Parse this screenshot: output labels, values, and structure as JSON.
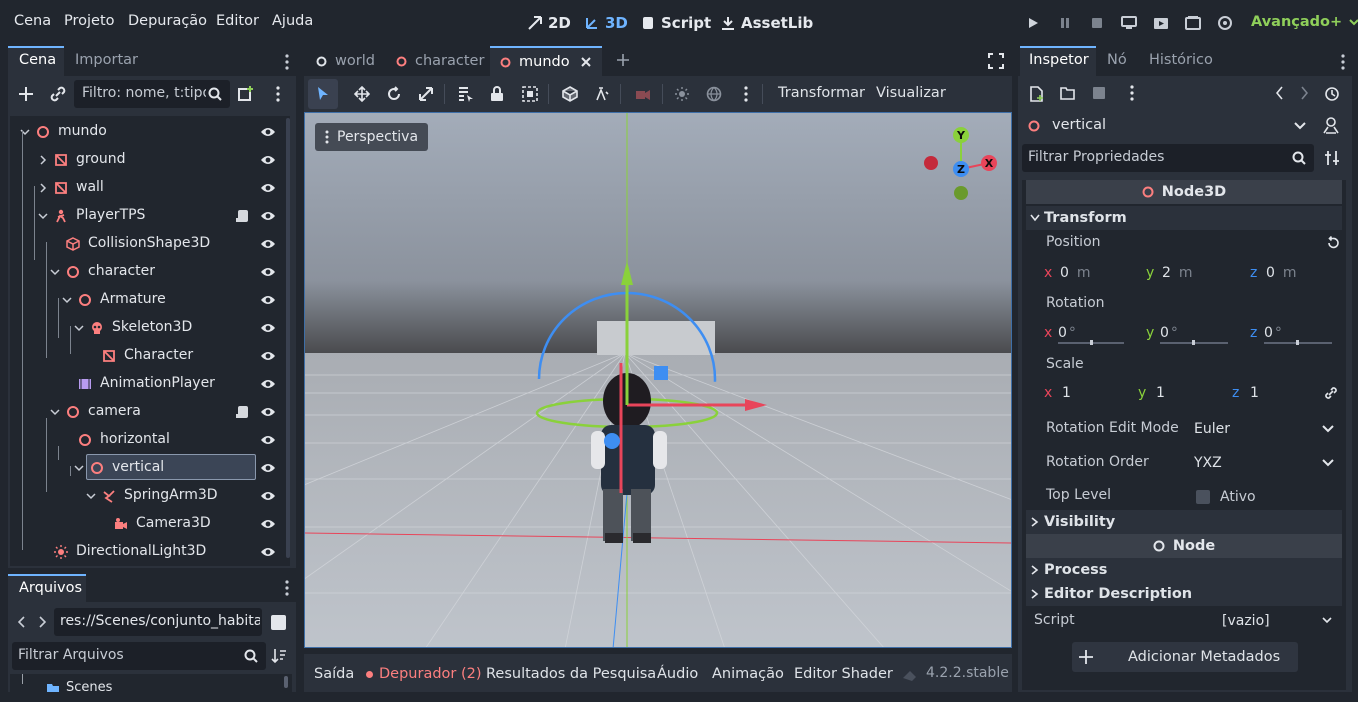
{
  "menu": {
    "cena": "Cena",
    "projeto": "Projeto",
    "depuracao": "Depuração",
    "editor": "Editor",
    "ajuda": "Ajuda"
  },
  "modes": {
    "m2d": "2D",
    "m3d": "3D",
    "script": "Script",
    "assetlib": "AssetLib"
  },
  "renderer": "Avançado+",
  "scene_panel": {
    "tabs": [
      "Cena",
      "Importar"
    ],
    "filter_placeholder": "Filtro: nome, t:tipo",
    "nodes": [
      {
        "label": "mundo",
        "depth": 0,
        "icon": "node3d-icon"
      },
      {
        "label": "ground",
        "depth": 1,
        "icon": "mesh-instance-icon"
      },
      {
        "label": "wall",
        "depth": 1,
        "icon": "mesh-instance-icon"
      },
      {
        "label": "PlayerTPS",
        "depth": 1,
        "icon": "character-body-icon"
      },
      {
        "label": "CollisionShape3D",
        "depth": 2,
        "icon": "collision-shape-icon"
      },
      {
        "label": "character",
        "depth": 2,
        "icon": "node3d-icon"
      },
      {
        "label": "Armature",
        "depth": 3,
        "icon": "node3d-icon"
      },
      {
        "label": "Skeleton3D",
        "depth": 4,
        "icon": "skeleton-icon"
      },
      {
        "label": "Character",
        "depth": 5,
        "icon": "mesh-instance-icon"
      },
      {
        "label": "AnimationPlayer",
        "depth": 3,
        "icon": "animation-player-icon"
      },
      {
        "label": "camera",
        "depth": 2,
        "icon": "node3d-icon"
      },
      {
        "label": "horizontal",
        "depth": 3,
        "icon": "node3d-icon"
      },
      {
        "label": "vertical",
        "depth": 4,
        "icon": "node3d-icon"
      },
      {
        "label": "SpringArm3D",
        "depth": 5,
        "icon": "spring-arm-icon"
      },
      {
        "label": "Camera3D",
        "depth": 6,
        "icon": "camera-icon"
      },
      {
        "label": "DirectionalLight3D",
        "depth": 1,
        "icon": "directional-light-icon"
      }
    ]
  },
  "files_panel": {
    "tab": "Arquivos",
    "path": "res://Scenes/conjunto_habitac",
    "filter_placeholder": "Filtrar Arquivos",
    "partial_item": "Scenes"
  },
  "editor_tabs": [
    "world",
    "character",
    "mundo"
  ],
  "toolbar": {
    "transformar": "Transformar",
    "visualizar": "Visualizar"
  },
  "viewport": {
    "perspective": "Perspectiva",
    "gizmo": {
      "x": "X",
      "y": "Y",
      "z": "Z"
    }
  },
  "bottom_tabs": {
    "saida": "Saída",
    "depurador": "Depurador (2)",
    "resultados": "Resultados da Pesquisa",
    "audio": "Áudio",
    "animacao": "Animação",
    "shader": "Editor Shader",
    "version": "4.2.2.stable"
  },
  "inspector": {
    "tabs": [
      "Inspetor",
      "Nó",
      "Histórico"
    ],
    "node_name": "vertical",
    "filter_placeholder": "Filtrar Propriedades",
    "class_header": "Node3D",
    "transform": "Transform",
    "position_label": "Position",
    "position": {
      "x": "0",
      "y": "2",
      "z": "0",
      "unit": "m"
    },
    "rotation_label": "Rotation",
    "rotation": {
      "x": "0",
      "y": "0",
      "z": "0",
      "unit": "°"
    },
    "scale_label": "Scale",
    "scale": {
      "x": "1",
      "y": "1",
      "z": "1"
    },
    "rotation_edit_mode_label": "Rotation Edit Mode",
    "rotation_edit_mode": "Euler",
    "rotation_order_label": "Rotation Order",
    "rotation_order": "YXZ",
    "top_level_label": "Top Level",
    "top_level_value": "Ativo",
    "visibility": "Visibility",
    "node_header": "Node",
    "process": "Process",
    "editor_description": "Editor Description",
    "script_label": "Script",
    "script_value": "[vazio]",
    "add_metadata": "Adicionar Metadados"
  },
  "colors": {
    "accent": "#6fb4ff",
    "node3d": "#fc7f7f",
    "x_axis": "#e8455a",
    "y_axis": "#8ad13b",
    "z_axis": "#3e8ef2",
    "renderer": "#8fcf5a"
  }
}
